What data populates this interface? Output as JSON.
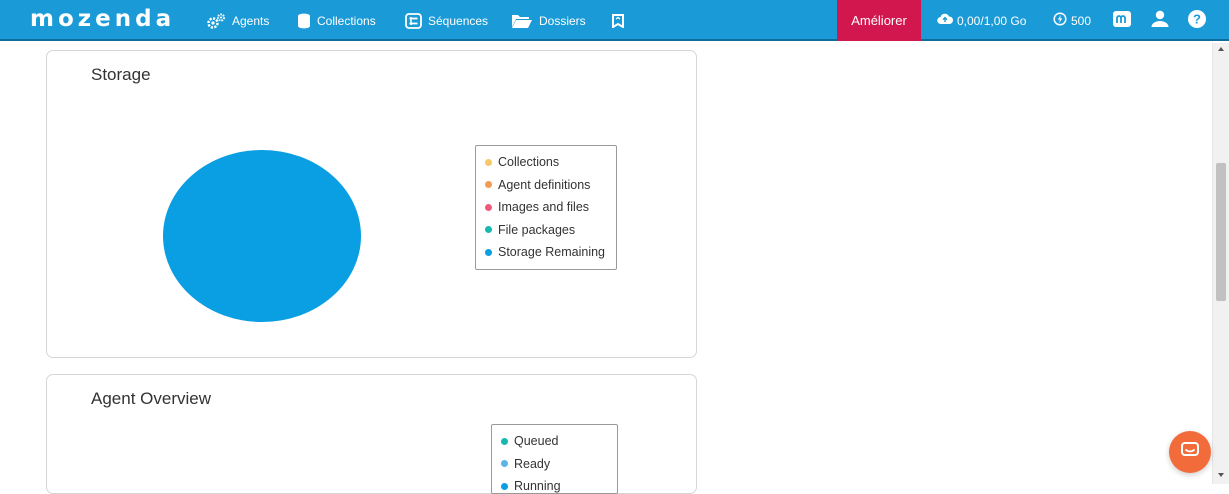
{
  "app": {
    "logo_text": "mozenda",
    "brand_color": "#1a9bd7",
    "upgrade_color": "#d1174d"
  },
  "nav": {
    "items": [
      {
        "label": "Agents",
        "icon": "gears-icon"
      },
      {
        "label": "Collections",
        "icon": "database-icon"
      },
      {
        "label": "Séquences",
        "icon": "sequence-icon"
      },
      {
        "label": "Dossiers",
        "icon": "folder-open-icon"
      },
      {
        "label": "",
        "icon": "bookmark-icon"
      }
    ],
    "upgrade_label": "Améliorer",
    "storage_usage": "0,00/1,00 Go",
    "credits": "500",
    "app_icon": "mozenda-m-icon",
    "user_icon": "user-icon",
    "help_icon": "help-icon"
  },
  "storage_card": {
    "title": "Storage",
    "legend": [
      {
        "label": "Collections",
        "color": "#f5c96a"
      },
      {
        "label": "Agent definitions",
        "color": "#f29b53"
      },
      {
        "label": "Images and files",
        "color": "#ef5a78"
      },
      {
        "label": "File packages",
        "color": "#17b8b0"
      },
      {
        "label": "Storage Remaining",
        "color": "#0a9ee2"
      }
    ]
  },
  "chart_data": {
    "type": "pie",
    "title": "Storage",
    "categories": [
      "Collections",
      "Agent definitions",
      "Images and files",
      "File packages",
      "Storage Remaining"
    ],
    "values": [
      0,
      0,
      0,
      0,
      1
    ],
    "colors": [
      "#f5c96a",
      "#f29b53",
      "#ef5a78",
      "#17b8b0",
      "#0a9ee2"
    ],
    "legend": "right"
  },
  "agents_card": {
    "title": "Agent Overview",
    "legend": [
      {
        "label": "Queued",
        "color": "#17b8b0"
      },
      {
        "label": "Ready",
        "color": "#5ab5e6"
      },
      {
        "label": "Running",
        "color": "#0a9ee2"
      }
    ]
  },
  "chat": {
    "icon": "chat-icon",
    "color": "#f26b3a"
  }
}
